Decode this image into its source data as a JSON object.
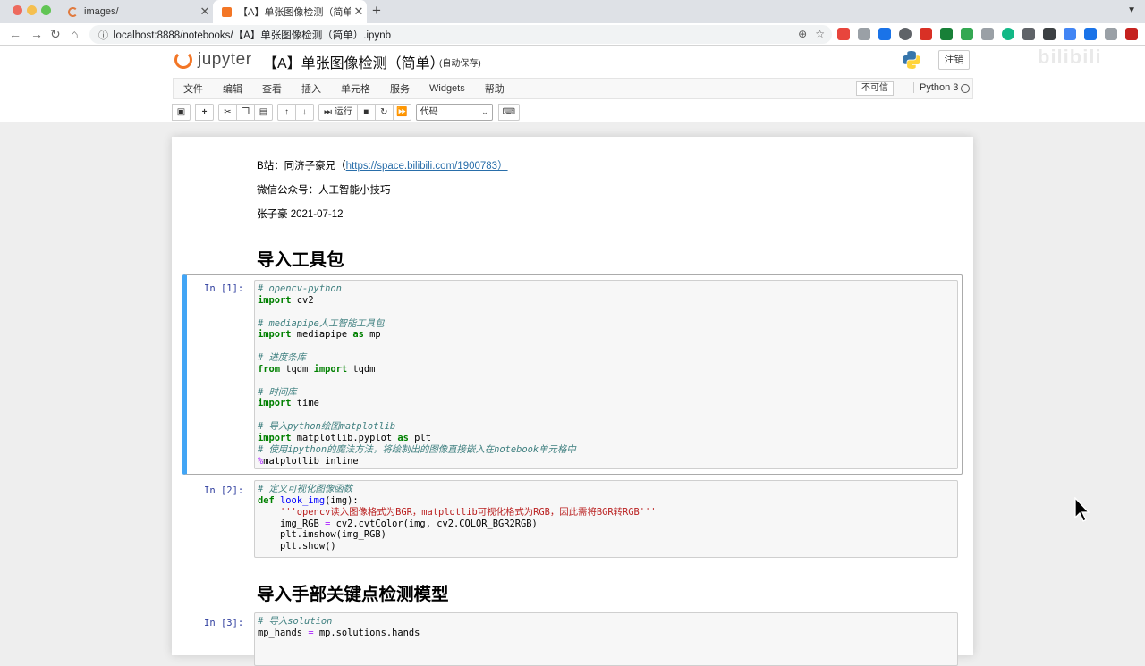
{
  "browser": {
    "tabs": [
      {
        "title": "images/"
      },
      {
        "title": "【A】单张图像检测（简单）- J"
      }
    ],
    "new_tab": "+",
    "address": "localhost:8888/notebooks/【A】单张图像检测（简单）.ipynb"
  },
  "jupyter": {
    "logo_text": "jupyter",
    "notebook_title": "【A】单张图像检测（简单）",
    "autosave": "(自动保存)",
    "logout": "注销",
    "watermark": "bilibili",
    "menu": [
      "文件",
      "编辑",
      "查看",
      "插入",
      "单元格",
      "服务",
      "Widgets",
      "帮助"
    ],
    "trust": "不可信",
    "kernel": "Python 3",
    "toolbar": {
      "run": "运行",
      "cell_type": "代码"
    }
  },
  "notebook": {
    "md_author_prefix": "B站：同济子豪兄（",
    "md_author_link": "https://space.bilibili.com/1900783）",
    "md_wechat": "微信公众号：人工智能小技巧",
    "md_date": "张子豪 2021-07-12",
    "heading1": "导入工具包",
    "heading2": "导入手部关键点检测模型",
    "cells": [
      {
        "prompt": "In [1]:"
      },
      {
        "prompt": "In [2]:"
      },
      {
        "prompt": "In [3]:"
      }
    ]
  }
}
